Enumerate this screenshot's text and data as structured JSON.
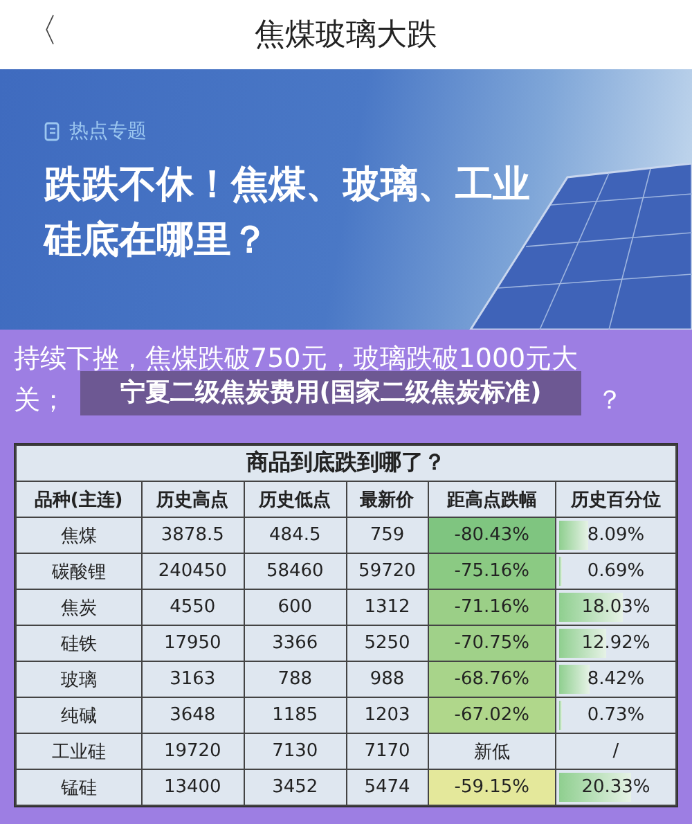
{
  "header": {
    "back_icon": "〈",
    "title": "焦煤玻璃大跌"
  },
  "banner": {
    "tag": "热点专题",
    "headline": "跌跌不休！焦煤、玻璃、工业硅底在哪里？"
  },
  "intro": {
    "line_1": "持续下挫，焦煤跌破750元，玻璃跌破1000元大",
    "line_2_start": "关；",
    "line_2_end": "？"
  },
  "overlay": {
    "caption": "宁夏二级焦炭费用(国家二级焦炭标准)"
  },
  "table": {
    "title": "商品到底跌到哪了？",
    "columns": [
      "品种(主连)",
      "历史高点",
      "历史低点",
      "最新价",
      "距高点跌幅",
      "历史百分位"
    ],
    "rows": [
      {
        "name": "焦煤",
        "high": "3878.5",
        "low": "484.5",
        "latest": "759",
        "drop": "-80.43%",
        "color": "#7fc580",
        "percentile": "8.09%",
        "level": 0.24
      },
      {
        "name": "碳酸锂",
        "high": "240450",
        "low": "58460",
        "latest": "59720",
        "drop": "-75.16%",
        "color": "#8bca83",
        "percentile": "0.69%",
        "level": 0.02
      },
      {
        "name": "焦炭",
        "high": "4550",
        "low": "600",
        "latest": "1312",
        "drop": "-71.16%",
        "color": "#9bcf87",
        "percentile": "18.03%",
        "level": 0.54
      },
      {
        "name": "硅铁",
        "high": "17950",
        "low": "3366",
        "latest": "5250",
        "drop": "-70.75%",
        "color": "#a0d189",
        "percentile": "12.92%",
        "level": 0.39
      },
      {
        "name": "玻璃",
        "high": "3163",
        "low": "788",
        "latest": "988",
        "drop": "-68.76%",
        "color": "#a8d48a",
        "percentile": "8.42%",
        "level": 0.25
      },
      {
        "name": "纯碱",
        "high": "3648",
        "low": "1185",
        "latest": "1203",
        "drop": "-67.02%",
        "color": "#b0d78b",
        "percentile": "0.73%",
        "level": 0.02
      },
      {
        "name": "工业硅",
        "high": "19720",
        "low": "7130",
        "latest": "7170",
        "drop": "新低",
        "percentile": "/",
        "level": 0
      },
      {
        "name": "锰硅",
        "high": "13400",
        "low": "3452",
        "latest": "5474",
        "drop": "-59.15%",
        "color": "#e4e89b",
        "percentile": "20.33%",
        "level": 0.61
      }
    ]
  }
}
